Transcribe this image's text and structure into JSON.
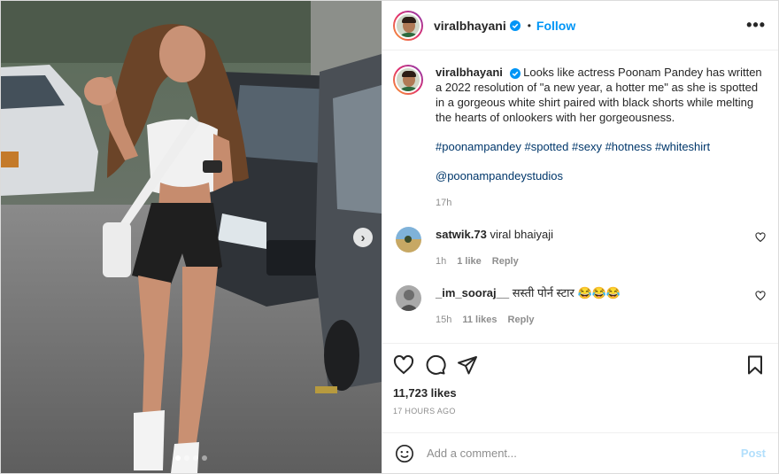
{
  "post": {
    "author": "viralbhayani",
    "follow_label": "Follow",
    "separator": "•",
    "more_label": "•••"
  },
  "caption": {
    "username": "viralbhayani",
    "text": "Looks like actress Poonam Pandey has written a 2022 resolution of \"a new year, a hotter me\" as she is spotted in a gorgeous white shirt paired with black shorts while melting the hearts of onlookers with her gorgeousness.",
    "hashtags": [
      "#poonampandey",
      "#spotted",
      "#sexy",
      "#hotness",
      "#whiteshirt"
    ],
    "mention": "@poonampandeystudios",
    "time": "17h"
  },
  "comments": [
    {
      "username": "satwik.73",
      "text": "viral bhaiyaji",
      "time": "1h",
      "likes": "1 like",
      "reply": "Reply"
    },
    {
      "username": "_im_sooraj__",
      "text": "सस्ती पोर्न स्टार 😂😂😂",
      "time": "15h",
      "likes": "11 likes",
      "reply": "Reply"
    }
  ],
  "stats": {
    "likes": "11,723 likes",
    "posted_ago": "17 HOURS AGO"
  },
  "composer": {
    "placeholder": "Add a comment...",
    "post_label": "Post"
  },
  "carousel": {
    "total": 4,
    "active_index": 0,
    "next_icon": "chevron-right-icon"
  },
  "colors": {
    "link_blue": "#0095f6",
    "hashtag_blue": "#00376b",
    "muted": "#8e8e8e",
    "post_disabled": "#b2dffc"
  }
}
